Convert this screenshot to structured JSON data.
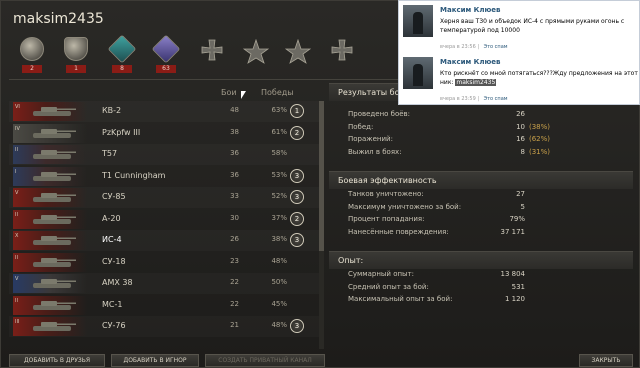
{
  "window": {
    "title": "maksim2435"
  },
  "medals": [
    {
      "icon": "tank-wreath-medal-icon",
      "count": "2"
    },
    {
      "icon": "shield-medal-icon",
      "count": "1"
    },
    {
      "icon": "tank-badge-medal-icon",
      "count": "8"
    },
    {
      "icon": "tank-badge-elite-icon",
      "count": "63"
    },
    {
      "icon": "iron-cross-medal-icon",
      "count": ""
    },
    {
      "icon": "star-medal-icon",
      "count": ""
    },
    {
      "icon": "star-medal-icon",
      "count": ""
    },
    {
      "icon": "iron-cross-medal-icon",
      "count": ""
    }
  ],
  "table": {
    "headers": {
      "battles": "Бои",
      "wins": "Победы"
    },
    "rows": [
      {
        "tier": "VI",
        "nation": "ussr",
        "name": "КВ-2",
        "battles": "48",
        "wins": "63%",
        "badge": "1"
      },
      {
        "tier": "IV",
        "nation": "germany",
        "name": "PzKpfw III",
        "battles": "38",
        "wins": "61%",
        "badge": "2"
      },
      {
        "tier": "II",
        "nation": "usa",
        "name": "T57",
        "battles": "36",
        "wins": "58%",
        "badge": ""
      },
      {
        "tier": "I",
        "nation": "usa",
        "name": "T1 Cunningham",
        "battles": "36",
        "wins": "53%",
        "badge": "3"
      },
      {
        "tier": "V",
        "nation": "ussr",
        "name": "СУ-85",
        "battles": "33",
        "wins": "52%",
        "badge": "3"
      },
      {
        "tier": "II",
        "nation": "ussr",
        "name": "А-20",
        "battles": "30",
        "wins": "37%",
        "badge": "2"
      },
      {
        "tier": "X",
        "nation": "ussr",
        "name": "ИС-4",
        "battles": "26",
        "wins": "38%",
        "badge": "3"
      },
      {
        "tier": "II",
        "nation": "ussr",
        "name": "СУ-18",
        "battles": "23",
        "wins": "48%",
        "badge": ""
      },
      {
        "tier": "V",
        "nation": "france",
        "name": "AMX 38",
        "battles": "22",
        "wins": "50%",
        "badge": ""
      },
      {
        "tier": "II",
        "nation": "ussr",
        "name": "МС-1",
        "battles": "22",
        "wins": "45%",
        "badge": ""
      },
      {
        "tier": "III",
        "nation": "ussr",
        "name": "СУ-76",
        "battles": "21",
        "wins": "48%",
        "badge": "3"
      }
    ]
  },
  "results": {
    "heading": "Результаты боя",
    "stats": [
      {
        "label": "Проведено боёв:",
        "value": "26",
        "pct": ""
      },
      {
        "label": "Побед:",
        "value": "10",
        "pct": "(38%)"
      },
      {
        "label": "Поражений:",
        "value": "16",
        "pct": "(62%)"
      },
      {
        "label": "Выжил в боях:",
        "value": "8",
        "pct": "(31%)"
      }
    ]
  },
  "efficiency": {
    "heading": "Боевая эффективность",
    "stats": [
      {
        "label": "Танков уничтожено:",
        "value": "27"
      },
      {
        "label": "Максимум уничтожено за бой:",
        "value": "5"
      },
      {
        "label": "Процент попадания:",
        "value": "79%"
      },
      {
        "label": "Нанесённые повреждения:",
        "value": "37 171"
      }
    ]
  },
  "experience": {
    "heading": "Опыт:",
    "stats": [
      {
        "label": "Суммарный опыт:",
        "value": "13 804"
      },
      {
        "label": "Средний опыт за бой:",
        "value": "531"
      },
      {
        "label": "Максимальный опыт за бой:",
        "value": "1 120"
      }
    ]
  },
  "buttons": {
    "add_friend": "ДОБАВИТЬ В ДРУЗЬЯ",
    "add_ignore": "ДОБАВИТЬ В ИГНОР",
    "private_channel": "СОЗДАТЬ ПРИВАТНЫЙ КАНАЛ",
    "close": "ЗАКРЫТЬ"
  },
  "vk_comments": [
    {
      "author": "Максим Клюев",
      "text": "Херня ваш Т30 и объедок ИС-4 с прямыми руками огонь с температурой под 10000",
      "time": "вчера в 23:56",
      "link": "Это спам"
    },
    {
      "author": "Максим Клюев",
      "text_before": "Кто рискнёт со мной потягаться???Жду предложения на этот ник: ",
      "text_highlight": "maksim2435",
      "time": "вчера в 23:59",
      "link": "Это спам"
    }
  ]
}
